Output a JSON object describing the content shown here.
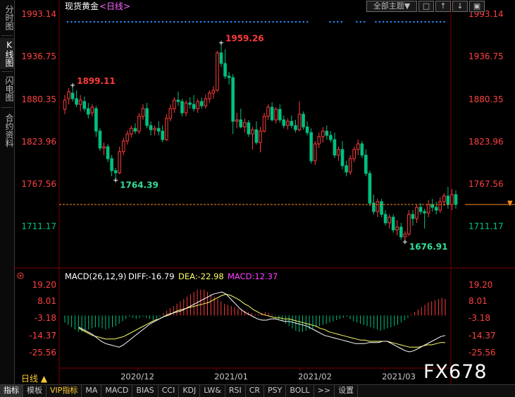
{
  "left_tabs": [
    {
      "label": "分时图",
      "active": false
    },
    {
      "label": "K线图",
      "active": true
    },
    {
      "label": "闪电图",
      "active": false
    },
    {
      "label": "合约资料",
      "active": false
    }
  ],
  "header": {
    "instrument": "现货黄金",
    "period": "<日线>",
    "theme_button": "全部主题▼",
    "icon_buttons": [
      "square-icon",
      "up-arrow-icon",
      "down-arrow-icon",
      "lock-icon"
    ]
  },
  "colors": {
    "up": "#ff3b3b",
    "down": "#00c080",
    "axis_label": "#ff4040",
    "dotted_line": "#2e8fff",
    "price_line": "#ff8c1a",
    "diff_line": "#ffffff",
    "dea_line": "#ffff66",
    "macd_label": "#ff44ff"
  },
  "chart_data": [
    {
      "type": "candlestick",
      "title": "现货黄金 <日线>",
      "y_ticks": [
        "1993.14",
        "1936.75",
        "1880.35",
        "1823.96",
        "1767.56",
        "1711.17"
      ],
      "ylim": [
        1660,
        2000
      ],
      "x_labels": [
        "2020/12",
        "2021/01",
        "2021/02",
        "2021/03"
      ],
      "annotations": [
        {
          "text": "1959.26",
          "value": 1959.26,
          "index": 40,
          "position": "above"
        },
        {
          "text": "1899.11",
          "value": 1899.11,
          "index": 2,
          "position": "above"
        },
        {
          "text": "1764.39",
          "value": 1764.39,
          "index": 13,
          "position": "below"
        },
        {
          "text": "1676.91",
          "value": 1676.91,
          "index": 87,
          "position": "below"
        }
      ],
      "current_price": 1730,
      "candles": [
        {
          "o": 1865,
          "h": 1885,
          "l": 1858,
          "c": 1878
        },
        {
          "o": 1880,
          "h": 1895,
          "l": 1872,
          "c": 1890
        },
        {
          "o": 1888,
          "h": 1899,
          "l": 1876,
          "c": 1880
        },
        {
          "o": 1880,
          "h": 1892,
          "l": 1868,
          "c": 1872
        },
        {
          "o": 1872,
          "h": 1885,
          "l": 1862,
          "c": 1878
        },
        {
          "o": 1876,
          "h": 1883,
          "l": 1862,
          "c": 1866
        },
        {
          "o": 1866,
          "h": 1874,
          "l": 1852,
          "c": 1858
        },
        {
          "o": 1860,
          "h": 1872,
          "l": 1855,
          "c": 1868
        },
        {
          "o": 1866,
          "h": 1870,
          "l": 1826,
          "c": 1834
        },
        {
          "o": 1834,
          "h": 1838,
          "l": 1806,
          "c": 1810
        },
        {
          "o": 1810,
          "h": 1818,
          "l": 1800,
          "c": 1812
        },
        {
          "o": 1812,
          "h": 1816,
          "l": 1790,
          "c": 1795
        },
        {
          "o": 1795,
          "h": 1800,
          "l": 1770,
          "c": 1778
        },
        {
          "o": 1778,
          "h": 1782,
          "l": 1764,
          "c": 1775
        },
        {
          "o": 1775,
          "h": 1812,
          "l": 1773,
          "c": 1805
        },
        {
          "o": 1805,
          "h": 1825,
          "l": 1800,
          "c": 1820
        },
        {
          "o": 1820,
          "h": 1835,
          "l": 1815,
          "c": 1830
        },
        {
          "o": 1830,
          "h": 1842,
          "l": 1825,
          "c": 1838
        },
        {
          "o": 1838,
          "h": 1845,
          "l": 1830,
          "c": 1834
        },
        {
          "o": 1834,
          "h": 1860,
          "l": 1830,
          "c": 1855
        },
        {
          "o": 1855,
          "h": 1872,
          "l": 1850,
          "c": 1866
        },
        {
          "o": 1866,
          "h": 1874,
          "l": 1838,
          "c": 1842
        },
        {
          "o": 1842,
          "h": 1848,
          "l": 1828,
          "c": 1836
        },
        {
          "o": 1836,
          "h": 1842,
          "l": 1828,
          "c": 1838
        },
        {
          "o": 1838,
          "h": 1848,
          "l": 1828,
          "c": 1834
        },
        {
          "o": 1834,
          "h": 1842,
          "l": 1818,
          "c": 1822
        },
        {
          "o": 1822,
          "h": 1858,
          "l": 1820,
          "c": 1852
        },
        {
          "o": 1852,
          "h": 1872,
          "l": 1848,
          "c": 1866
        },
        {
          "o": 1866,
          "h": 1882,
          "l": 1860,
          "c": 1878
        },
        {
          "o": 1878,
          "h": 1890,
          "l": 1870,
          "c": 1876
        },
        {
          "o": 1876,
          "h": 1880,
          "l": 1855,
          "c": 1860
        },
        {
          "o": 1860,
          "h": 1878,
          "l": 1855,
          "c": 1874
        },
        {
          "o": 1874,
          "h": 1882,
          "l": 1866,
          "c": 1872
        },
        {
          "o": 1872,
          "h": 1885,
          "l": 1862,
          "c": 1866
        },
        {
          "o": 1866,
          "h": 1880,
          "l": 1860,
          "c": 1876
        },
        {
          "o": 1876,
          "h": 1882,
          "l": 1866,
          "c": 1870
        },
        {
          "o": 1870,
          "h": 1886,
          "l": 1866,
          "c": 1880
        },
        {
          "o": 1880,
          "h": 1892,
          "l": 1874,
          "c": 1888
        },
        {
          "o": 1888,
          "h": 1898,
          "l": 1880,
          "c": 1892
        },
        {
          "o": 1892,
          "h": 1948,
          "l": 1890,
          "c": 1945
        },
        {
          "o": 1945,
          "h": 1959,
          "l": 1925,
          "c": 1930
        },
        {
          "o": 1930,
          "h": 1950,
          "l": 1908,
          "c": 1912
        },
        {
          "o": 1912,
          "h": 1918,
          "l": 1900,
          "c": 1910
        },
        {
          "o": 1910,
          "h": 1915,
          "l": 1830,
          "c": 1848
        },
        {
          "o": 1848,
          "h": 1860,
          "l": 1838,
          "c": 1850
        },
        {
          "o": 1850,
          "h": 1866,
          "l": 1838,
          "c": 1840
        },
        {
          "o": 1840,
          "h": 1852,
          "l": 1832,
          "c": 1846
        },
        {
          "o": 1846,
          "h": 1850,
          "l": 1826,
          "c": 1830
        },
        {
          "o": 1830,
          "h": 1840,
          "l": 1808,
          "c": 1836
        },
        {
          "o": 1836,
          "h": 1848,
          "l": 1815,
          "c": 1818
        },
        {
          "o": 1818,
          "h": 1840,
          "l": 1804,
          "c": 1834
        },
        {
          "o": 1834,
          "h": 1860,
          "l": 1832,
          "c": 1855
        },
        {
          "o": 1855,
          "h": 1872,
          "l": 1850,
          "c": 1868
        },
        {
          "o": 1868,
          "h": 1875,
          "l": 1848,
          "c": 1850
        },
        {
          "o": 1850,
          "h": 1868,
          "l": 1845,
          "c": 1865
        },
        {
          "o": 1865,
          "h": 1872,
          "l": 1846,
          "c": 1850
        },
        {
          "o": 1850,
          "h": 1856,
          "l": 1838,
          "c": 1842
        },
        {
          "o": 1842,
          "h": 1852,
          "l": 1836,
          "c": 1848
        },
        {
          "o": 1848,
          "h": 1856,
          "l": 1838,
          "c": 1842
        },
        {
          "o": 1842,
          "h": 1850,
          "l": 1832,
          "c": 1836
        },
        {
          "o": 1836,
          "h": 1876,
          "l": 1834,
          "c": 1858
        },
        {
          "o": 1858,
          "h": 1862,
          "l": 1836,
          "c": 1840
        },
        {
          "o": 1840,
          "h": 1848,
          "l": 1828,
          "c": 1832
        },
        {
          "o": 1832,
          "h": 1838,
          "l": 1788,
          "c": 1792
        },
        {
          "o": 1792,
          "h": 1820,
          "l": 1786,
          "c": 1816
        },
        {
          "o": 1816,
          "h": 1832,
          "l": 1810,
          "c": 1826
        },
        {
          "o": 1826,
          "h": 1840,
          "l": 1818,
          "c": 1834
        },
        {
          "o": 1834,
          "h": 1842,
          "l": 1822,
          "c": 1828
        },
        {
          "o": 1828,
          "h": 1834,
          "l": 1818,
          "c": 1822
        },
        {
          "o": 1822,
          "h": 1832,
          "l": 1796,
          "c": 1800
        },
        {
          "o": 1800,
          "h": 1812,
          "l": 1792,
          "c": 1808
        },
        {
          "o": 1808,
          "h": 1820,
          "l": 1780,
          "c": 1785
        },
        {
          "o": 1785,
          "h": 1792,
          "l": 1770,
          "c": 1776
        },
        {
          "o": 1776,
          "h": 1800,
          "l": 1772,
          "c": 1795
        },
        {
          "o": 1795,
          "h": 1812,
          "l": 1790,
          "c": 1808
        },
        {
          "o": 1808,
          "h": 1822,
          "l": 1800,
          "c": 1816
        },
        {
          "o": 1816,
          "h": 1820,
          "l": 1796,
          "c": 1800
        },
        {
          "o": 1800,
          "h": 1808,
          "l": 1770,
          "c": 1774
        },
        {
          "o": 1774,
          "h": 1778,
          "l": 1728,
          "c": 1732
        },
        {
          "o": 1732,
          "h": 1744,
          "l": 1716,
          "c": 1720
        },
        {
          "o": 1720,
          "h": 1738,
          "l": 1712,
          "c": 1734
        },
        {
          "o": 1734,
          "h": 1738,
          "l": 1712,
          "c": 1716
        },
        {
          "o": 1716,
          "h": 1722,
          "l": 1700,
          "c": 1704
        },
        {
          "o": 1704,
          "h": 1716,
          "l": 1696,
          "c": 1712
        },
        {
          "o": 1712,
          "h": 1716,
          "l": 1690,
          "c": 1694
        },
        {
          "o": 1694,
          "h": 1708,
          "l": 1686,
          "c": 1698
        },
        {
          "o": 1698,
          "h": 1704,
          "l": 1680,
          "c": 1684
        },
        {
          "o": 1684,
          "h": 1692,
          "l": 1677,
          "c": 1688
        },
        {
          "o": 1688,
          "h": 1722,
          "l": 1686,
          "c": 1716
        },
        {
          "o": 1716,
          "h": 1722,
          "l": 1700,
          "c": 1710
        },
        {
          "o": 1710,
          "h": 1730,
          "l": 1704,
          "c": 1726
        },
        {
          "o": 1726,
          "h": 1732,
          "l": 1716,
          "c": 1720
        },
        {
          "o": 1720,
          "h": 1724,
          "l": 1696,
          "c": 1718
        },
        {
          "o": 1718,
          "h": 1736,
          "l": 1712,
          "c": 1730
        },
        {
          "o": 1730,
          "h": 1738,
          "l": 1720,
          "c": 1726
        },
        {
          "o": 1726,
          "h": 1734,
          "l": 1716,
          "c": 1722
        },
        {
          "o": 1722,
          "h": 1740,
          "l": 1718,
          "c": 1734
        },
        {
          "o": 1734,
          "h": 1746,
          "l": 1728,
          "c": 1742
        },
        {
          "o": 1742,
          "h": 1755,
          "l": 1724,
          "c": 1730
        },
        {
          "o": 1730,
          "h": 1752,
          "l": 1722,
          "c": 1744
        },
        {
          "o": 1744,
          "h": 1750,
          "l": 1724,
          "c": 1730
        }
      ]
    },
    {
      "type": "macd",
      "title": "MACD(26,12,9)",
      "diff_label": "DIFF:-16.79",
      "dea_label": "DEA:-22.98",
      "macd_label": "MACD:12.37",
      "y_ticks": [
        "19.20",
        "8.01",
        "-3.18",
        "-14.37",
        "-25.56"
      ],
      "ylim": [
        -34,
        26
      ],
      "histogram": [
        -6,
        -8,
        -10,
        -12,
        -14,
        -14,
        -13,
        -12,
        -11,
        -10,
        -10,
        -11,
        -12,
        -11,
        -10,
        -9,
        -7,
        -5,
        -3,
        -1,
        -2,
        -3,
        -2,
        -1,
        -2,
        -3,
        -4,
        -3,
        -1,
        2,
        4,
        6,
        8,
        10,
        12,
        14,
        16,
        18,
        20,
        22,
        22,
        22,
        20,
        18,
        16,
        14,
        12,
        10,
        9,
        8,
        7,
        6,
        5,
        4,
        3,
        2,
        1,
        1,
        2,
        3,
        2,
        1,
        -1,
        -3,
        -5,
        -7,
        -9,
        -11,
        -13,
        -14,
        -14,
        -13,
        -12,
        -11,
        -10,
        -9,
        -8,
        -7,
        -6,
        -5,
        -4,
        -3,
        -2,
        -1,
        -3,
        -5,
        -6,
        -7,
        -8,
        -9,
        -10,
        -11,
        -12,
        -13,
        -12,
        -11,
        -10,
        -9,
        -8,
        -6,
        -4,
        -2,
        1,
        3,
        5,
        7,
        9,
        11,
        12,
        13,
        14,
        15,
        14
      ],
      "diff": [
        -10,
        -12,
        -14,
        -16,
        -19,
        -22,
        -24,
        -25,
        -26,
        -27,
        -25,
        -22,
        -19,
        -16,
        -13,
        -10,
        -7,
        -5,
        -3,
        -1,
        1,
        2,
        3,
        4,
        6,
        8,
        10,
        12,
        14,
        16,
        18,
        19,
        20,
        18,
        14,
        10,
        6,
        3,
        1,
        -1,
        -3,
        -4,
        -4,
        -3,
        -3,
        -4,
        -5,
        -5,
        -6,
        -7,
        -8,
        -9,
        -11,
        -13,
        -15,
        -17,
        -18,
        -19,
        -20,
        -21,
        -22,
        -23,
        -24,
        -24,
        -24,
        -23,
        -23,
        -23,
        -22,
        -22,
        -24,
        -26,
        -28,
        -30,
        -31,
        -30,
        -28,
        -26,
        -24,
        -22,
        -20,
        -18,
        -17
      ],
      "dea": [
        -11,
        -13,
        -15,
        -17,
        -18,
        -19,
        -20,
        -20,
        -20,
        -19,
        -18,
        -16,
        -14,
        -12,
        -10,
        -8,
        -6,
        -4,
        -3,
        -1,
        0,
        2,
        4,
        5,
        6,
        7,
        8,
        9,
        10,
        11,
        13,
        15,
        17,
        18,
        17,
        15,
        13,
        10,
        8,
        5,
        3,
        1,
        0,
        -1,
        -2,
        -2,
        -3,
        -3,
        -4,
        -5,
        -6,
        -7,
        -8,
        -9,
        -11,
        -12,
        -14,
        -15,
        -16,
        -17,
        -18,
        -19,
        -20,
        -21,
        -21,
        -22,
        -22,
        -22,
        -22,
        -22,
        -23,
        -24,
        -25,
        -26,
        -27,
        -27,
        -27,
        -26,
        -25,
        -25,
        -24,
        -23,
        -23
      ]
    }
  ],
  "bottom_tabs": [
    {
      "label": "指标",
      "active": true,
      "vip": false
    },
    {
      "label": "模板",
      "active": false,
      "vip": false
    },
    {
      "label": "VIP指标",
      "active": false,
      "vip": true
    },
    {
      "label": "MA",
      "active": false,
      "vip": false
    },
    {
      "label": "MACD",
      "active": false,
      "vip": false
    },
    {
      "label": "BIAS",
      "active": false,
      "vip": false
    },
    {
      "label": "CCI",
      "active": false,
      "vip": false
    },
    {
      "label": "KDJ",
      "active": false,
      "vip": false
    },
    {
      "label": "LW&",
      "active": false,
      "vip": false
    },
    {
      "label": "RSI",
      "active": false,
      "vip": false
    },
    {
      "label": "CR",
      "active": false,
      "vip": false
    },
    {
      "label": "PSY",
      "active": false,
      "vip": false
    },
    {
      "label": "BOLL",
      "active": false,
      "vip": false
    },
    {
      "label": ">>",
      "active": false,
      "vip": false
    },
    {
      "label": "设置",
      "active": false,
      "vip": false
    }
  ],
  "period_selector": "日线 ▲",
  "watermark": "FX678"
}
